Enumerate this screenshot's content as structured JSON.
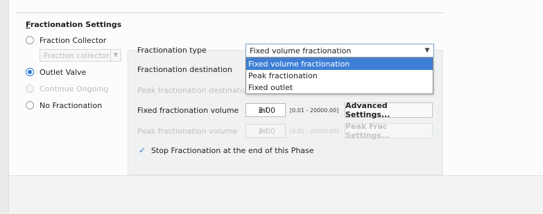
{
  "section": {
    "title_first": "F",
    "title_rest": "ractionation Settings"
  },
  "radios": [
    {
      "label": "Fraction Collector",
      "selected": false,
      "enabled": true
    },
    {
      "label": "Outlet Valve",
      "selected": true,
      "enabled": true
    },
    {
      "label": "Continue Ongoing",
      "selected": false,
      "enabled": false
    },
    {
      "label": "No Fractionation",
      "selected": false,
      "enabled": true
    }
  ],
  "fraction_collector_select": {
    "value": "Fraction collector"
  },
  "form": {
    "type_label": "Fractionation type",
    "type_value": "Fixed volume fractionation",
    "dropdown_options": [
      "Fixed volume fractionation",
      "Peak fractionation",
      "Fixed outlet"
    ],
    "dropdown_selected_index": 0,
    "destination_label": "Fractionation destination",
    "peak_destination_label": "Peak fractionation destination",
    "fixed_volume_label": "Fixed fractionation volume",
    "fixed_volume_value": "2.00",
    "fixed_volume_unit": "ml",
    "fixed_volume_range": "[0.01 - 20000.00]",
    "advanced_button": "Advanced Settings...",
    "peak_volume_label": "Peak fractionation volume",
    "peak_volume_value": "2.00",
    "peak_volume_unit": "ml",
    "peak_volume_range": "[0.01 - 20000.00]",
    "peak_frac_button": "Peak Frac Settings...",
    "stop_checkbox_label": "Stop Fractionation at the end of this Phase",
    "stop_checked": true
  },
  "colors": {
    "accent": "#2a78d6",
    "selection": "#3d7fd6",
    "panel": "#eff1f2"
  },
  "icons": {
    "dropdown": "chevron-down-icon",
    "check": "checkmark-icon"
  }
}
